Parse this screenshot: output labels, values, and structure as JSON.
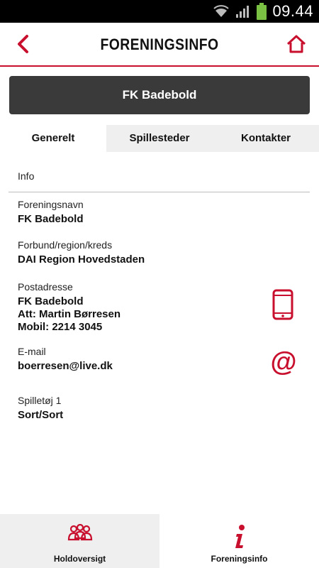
{
  "status_bar": {
    "time": "09.44"
  },
  "header": {
    "title": "FORENINGSINFO",
    "back_icon": "chevron-left-icon",
    "home_icon": "home-icon",
    "accent_color": "#c8102e"
  },
  "club": {
    "name": "FK Badebold"
  },
  "tabs": [
    {
      "label": "Generelt",
      "active": true
    },
    {
      "label": "Spillesteder",
      "active": false
    },
    {
      "label": "Kontakter",
      "active": false
    }
  ],
  "info": {
    "section_title": "Info",
    "fields": {
      "foreningsnavn": {
        "label": "Foreningsnavn",
        "value": "FK Badebold"
      },
      "forbund": {
        "label": "Forbund/region/kreds",
        "value": "DAI Region Hovedstaden"
      },
      "postadresse": {
        "label": "Postadresse",
        "lines": [
          "FK Badebold",
          "Att: Martin Børresen",
          "Mobil: 2214 3045"
        ]
      },
      "email": {
        "label": "E-mail",
        "value": "boerresen@live.dk",
        "icon_glyph": "@"
      },
      "spilletoej": {
        "label": "Spilletøj 1",
        "value": "Sort/Sort"
      }
    }
  },
  "bottom_nav": [
    {
      "label": "Holdoversigt",
      "icon": "team-icon",
      "active": false
    },
    {
      "label": "Foreningsinfo",
      "icon": "info-icon",
      "active": true
    }
  ]
}
